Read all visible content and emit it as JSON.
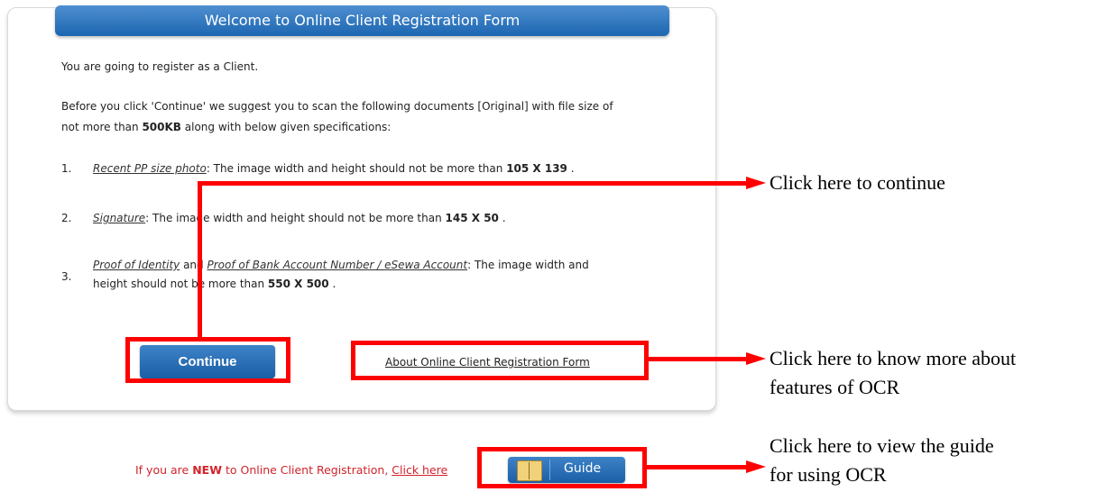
{
  "header": {
    "title": "Welcome to Online Client Registration Form"
  },
  "intro": "You are going to register as a Client.",
  "instructions": {
    "line1": "Before you click 'Continue' we suggest you to scan the following documents [Original] with file size of",
    "line2_pre": "not more than ",
    "line2_bold": "500KB",
    "line2_post": " along with below given specifications:"
  },
  "items": [
    {
      "num": "1.",
      "link": "Recent PP size photo",
      "text": ": The image width and height should not be more than ",
      "bold": "105 X 139",
      "tail": " ."
    },
    {
      "num": "2.",
      "link": "Signature",
      "text": ": The image width and height should not be more than ",
      "bold": "145 X 50",
      "tail": " ."
    },
    {
      "num": "3.",
      "link1": "Proof of Identity",
      "mid": " and ",
      "link2": "Proof of Bank Account Number / eSewa Account",
      "text": ": The image width and",
      "line2": "height should not be more than ",
      "bold": "550 X 500",
      "tail": " ."
    }
  ],
  "buttons": {
    "continue": "Continue",
    "about": "About Online Client Registration Form"
  },
  "footer": {
    "pre": "If you are ",
    "new": "NEW",
    "mid": " to Online Client Registration, ",
    "link": "Click here",
    "guide": "Guide"
  },
  "callouts": {
    "continue": "Click here to continue",
    "about_1": "Click here to know more about",
    "about_2": "features of OCR",
    "guide_1": "Click here to view the guide",
    "guide_2": "for using OCR"
  },
  "colors": {
    "accent": "#1c66b1",
    "annotation": "#ff0000",
    "footer_text": "#d2232a"
  },
  "icons": {
    "guide": "book-icon"
  }
}
